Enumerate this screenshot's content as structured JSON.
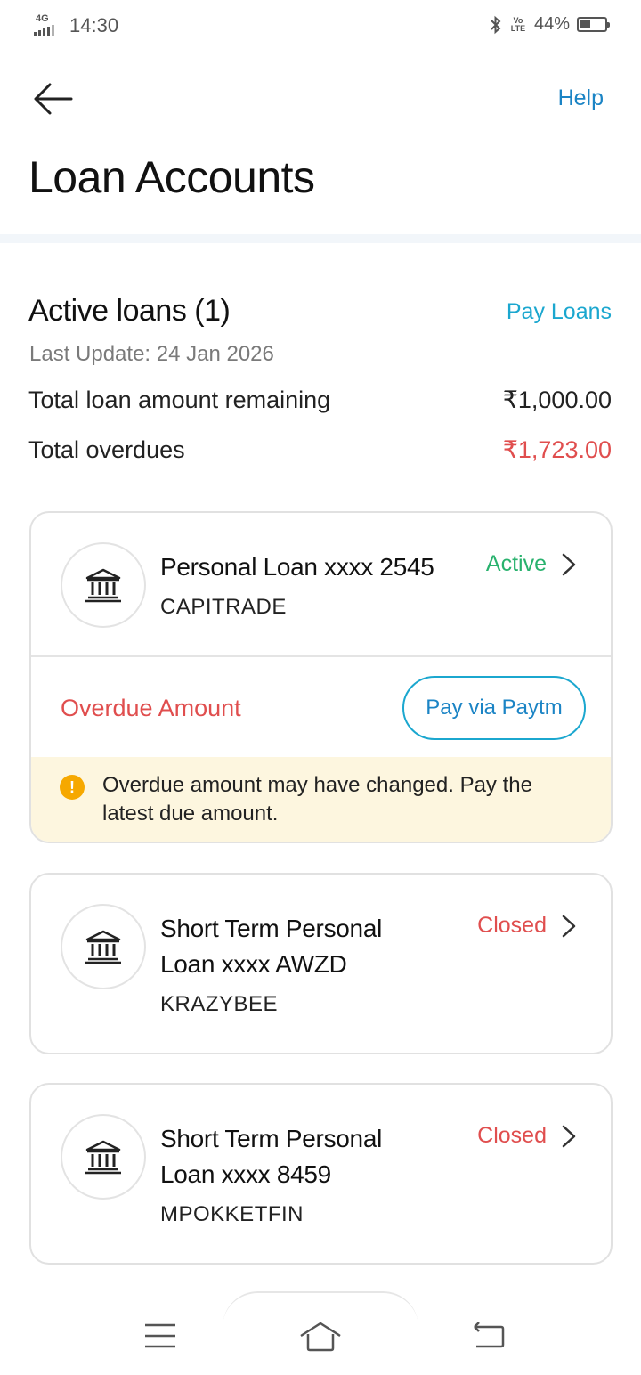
{
  "status_bar": {
    "network": "4G",
    "time": "14:30",
    "volte": "Vo LTE",
    "battery": "44%",
    "battery_level": 0.44
  },
  "header": {
    "help_label": "Help",
    "title": "Loan Accounts"
  },
  "summary": {
    "title": "Active loans (1)",
    "pay_loans_label": "Pay Loans",
    "last_update": "Last Update: 24 Jan 2026",
    "rows": [
      {
        "label": "Total loan amount remaining",
        "value": "₹1,000.00"
      },
      {
        "label": "Total overdues",
        "value": "₹1,723.00"
      }
    ]
  },
  "loans": [
    {
      "name": "Personal Loan xxxx 2545",
      "lender": "CAPITRADE",
      "status": "Active",
      "overdue_label": "Overdue Amount",
      "pay_button": "Pay via Paytm",
      "warning": "Overdue amount may have changed. Pay the latest due amount."
    },
    {
      "name": "Short Term Personal Loan xxxx AWZD",
      "lender": "KRAZYBEE",
      "status": "Closed"
    },
    {
      "name": "Short Term Personal Loan xxxx 8459",
      "lender": "MPOKKETFIN",
      "status": "Closed"
    }
  ],
  "colors": {
    "accent_blue": "#1ba7cf",
    "help_blue": "#1b84c5",
    "active_green": "#29b26e",
    "overdue_red": "#e04e4e",
    "warning_bg": "#fdf6df"
  }
}
